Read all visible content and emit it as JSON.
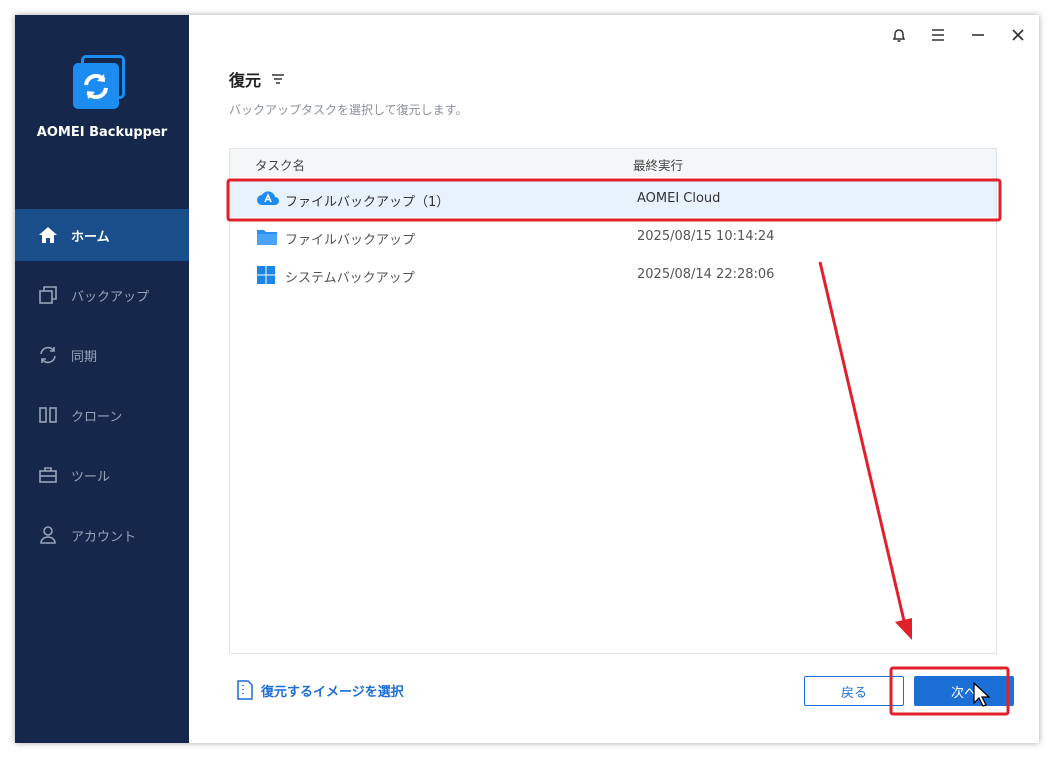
{
  "app": {
    "name": "AOMEI Backupper"
  },
  "sidebar": {
    "items": [
      {
        "label": "ホーム",
        "icon": "home-icon",
        "active": true
      },
      {
        "label": "バックアップ",
        "icon": "backup-icon",
        "active": false
      },
      {
        "label": "同期",
        "icon": "sync-icon",
        "active": false
      },
      {
        "label": "クローン",
        "icon": "clone-icon",
        "active": false
      },
      {
        "label": "ツール",
        "icon": "toolbox-icon",
        "active": false
      },
      {
        "label": "アカウント",
        "icon": "user-icon",
        "active": false
      }
    ]
  },
  "window_controls": [
    "bell-icon",
    "menu-icon",
    "minimize-icon",
    "close-icon"
  ],
  "page": {
    "title": "復元",
    "subtitle": "バックアップタスクを選択して復元します。"
  },
  "table": {
    "columns": [
      "タスク名",
      "最終実行"
    ],
    "rows": [
      {
        "name": "ファイルバックアップ（1）",
        "last_run": "AOMEI Cloud",
        "icon": "cloud-icon",
        "selected": true
      },
      {
        "name": "ファイルバックアップ",
        "last_run": "2025/08/15 10:14:24",
        "icon": "folder-icon",
        "selected": false
      },
      {
        "name": "システムバックアップ",
        "last_run": "2025/08/14 22:28:06",
        "icon": "windows-icon",
        "selected": false
      }
    ]
  },
  "footer": {
    "select_image_label": "復元するイメージを選択",
    "back_label": "戻る",
    "next_label": "次へ"
  },
  "colors": {
    "sidebar_bg": "#15284b",
    "sidebar_active": "#1a4e8a",
    "accent": "#1c6fd6",
    "highlight_annotation": "#e0212b"
  }
}
